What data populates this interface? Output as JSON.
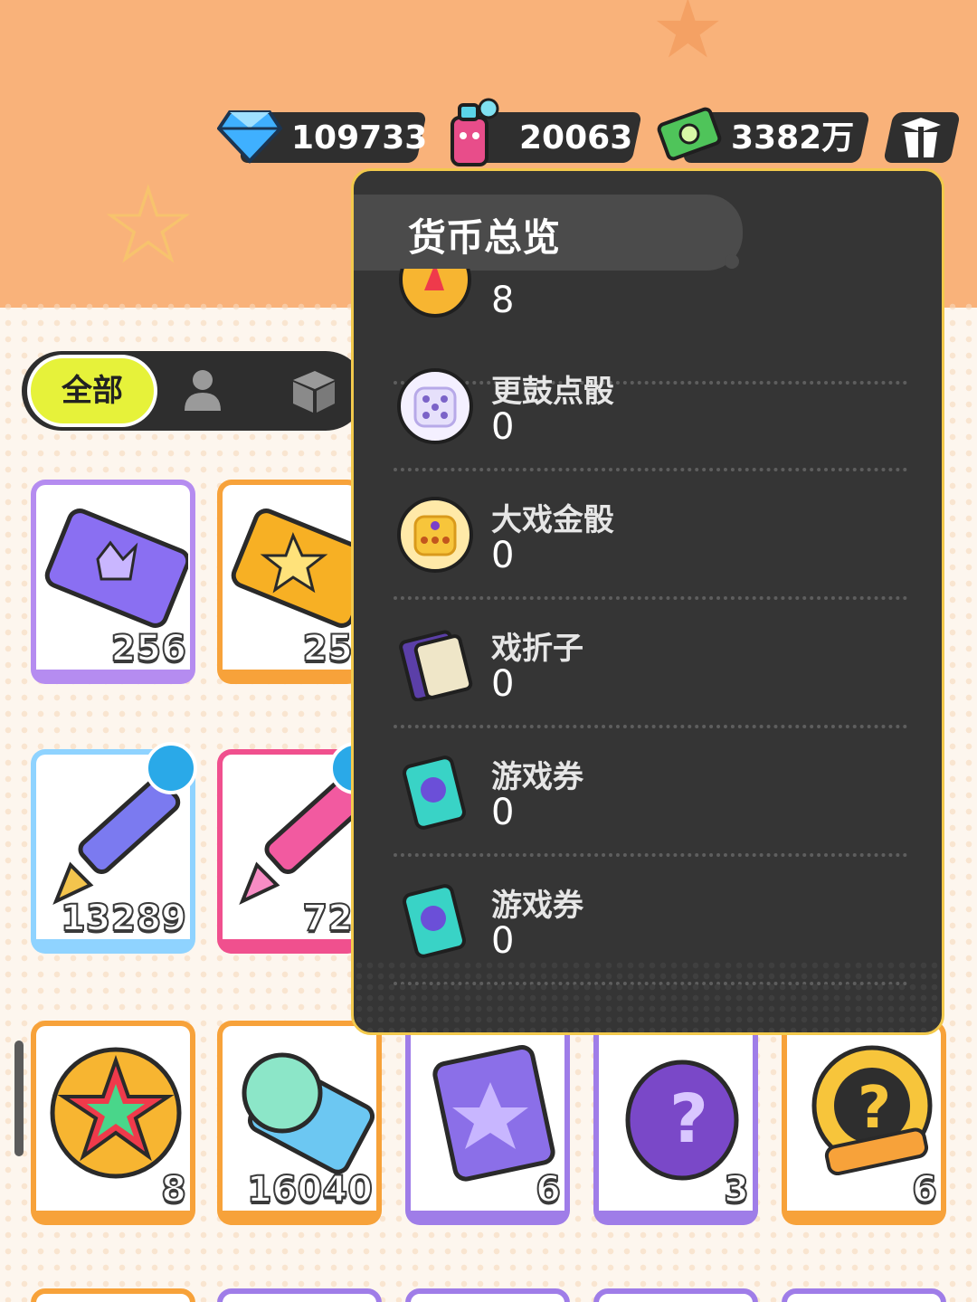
{
  "currencies": [
    {
      "name": "diamond-icon",
      "value": "109733",
      "color": "#39a8f4"
    },
    {
      "name": "spray-can-icon",
      "value": "20063",
      "color": "#e84d8a"
    },
    {
      "name": "cash-icon",
      "value": "3382万",
      "color": "#4fc45a"
    },
    {
      "name": "gift-box-icon",
      "value": ""
    }
  ],
  "tabs": {
    "all_label": "全部",
    "items": [
      "person-icon",
      "box-icon"
    ]
  },
  "popover": {
    "title": "货币总览",
    "partial_top": {
      "value": "8",
      "icon": "star-badge-icon"
    },
    "rows": [
      {
        "name": "更鼓点骰",
        "value": "0",
        "icon": "white-dice-icon"
      },
      {
        "name": "大戏金骰",
        "value": "0",
        "icon": "gold-dice-icon"
      },
      {
        "name": "戏折子",
        "value": "0",
        "icon": "booklet-icon"
      },
      {
        "name": "游戏券",
        "value": "0",
        "icon": "ticket-icon"
      },
      {
        "name": "游戏券",
        "value": "0",
        "icon": "ticket-icon"
      }
    ]
  },
  "cards": [
    {
      "qty": "256",
      "icon": "purple-ticket-icon",
      "border": "rainbow"
    },
    {
      "qty": "25",
      "icon": "gold-ticket-icon",
      "border": "#f7a23a"
    },
    {
      "qty": "13289",
      "icon": "rainbow-crayon-icon",
      "border": "rainbow"
    },
    {
      "qty": "72",
      "icon": "pink-crayon-icon",
      "border": "#f0508e"
    },
    {
      "qty": "8",
      "icon": "star-badge-icon",
      "border": "#f7a23a"
    },
    {
      "qty": "16040",
      "icon": "season-ticket-icon",
      "border": "#f7a23a"
    },
    {
      "qty": "6",
      "icon": "travel-card-icon",
      "border": "#9f7de8"
    },
    {
      "qty": "3",
      "icon": "mystery-egg-icon",
      "border": "#9f7de8"
    },
    {
      "qty": "6",
      "icon": "mystery-badge-icon",
      "border": "#f7a23a"
    }
  ]
}
